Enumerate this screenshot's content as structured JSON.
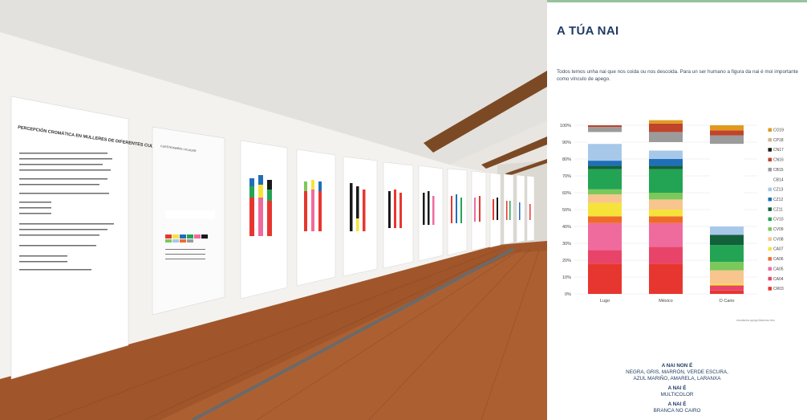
{
  "photo": {
    "panels": [
      {
        "heading": "PERCEPCIÓN CROMÁTICA EN MULLERES DE DIFERENTES CULTURAS"
      },
      {
        "heading": "CUESTIONARIO / PLACER"
      }
    ]
  },
  "poster": {
    "title": "A TÚA NAI",
    "intro": "Todos temos unha nai que nos coida ou nos descoida. Para un ser humano a figura da nai é moi importante como vínculo de apego.",
    "source_note": "resultados.apego/historias.tres",
    "bottom": {
      "line1": "A NAI NON É",
      "line2": "NEGRA, GRIS, MARRÓN, VERDE ESCURA,",
      "line3": "AZUL MARIÑO, AMARELA, LARANXA",
      "line4": "A NAI É",
      "line5": "MULTICOLOR",
      "line6": "A NAI É",
      "line7": "BRANCA NO CAIRO"
    }
  },
  "chart_data": {
    "type": "bar",
    "stacked": true,
    "categories": [
      "Lugo",
      "México",
      "O Cairo"
    ],
    "y_ticks": [
      "0%",
      "10%",
      "20%",
      "30%",
      "40%",
      "50%",
      "60%",
      "70%",
      "80%",
      "90%",
      "100%"
    ],
    "ylim": [
      0,
      100
    ],
    "grid": true,
    "legend_position": "right",
    "series": [
      {
        "name": "CR03",
        "color": "#e7362f",
        "values": [
          18,
          18,
          2
        ]
      },
      {
        "name": "CA04",
        "color": "#e8446a",
        "values": [
          8,
          10,
          3
        ]
      },
      {
        "name": "CA05",
        "color": "#f06b9d",
        "values": [
          16,
          14,
          0
        ]
      },
      {
        "name": "CA06",
        "color": "#ef6b2a",
        "values": [
          4,
          4,
          0
        ]
      },
      {
        "name": "CA07",
        "color": "#f6e33a",
        "values": [
          8,
          4,
          1
        ]
      },
      {
        "name": "CV08",
        "color": "#f8c58e",
        "values": [
          5,
          6,
          8
        ]
      },
      {
        "name": "CV09",
        "color": "#7ac95a",
        "values": [
          3,
          4,
          5
        ]
      },
      {
        "name": "CV10",
        "color": "#23a455",
        "values": [
          12,
          14,
          10
        ]
      },
      {
        "name": "CZ11",
        "color": "#12613a",
        "values": [
          2,
          2,
          6
        ]
      },
      {
        "name": "CZ12",
        "color": "#1f6fb8",
        "values": [
          3,
          4,
          0
        ]
      },
      {
        "name": "CZ13",
        "color": "#a8c8ea",
        "values": [
          10,
          5,
          5
        ]
      },
      {
        "name": "CB14",
        "color": "#ffffff",
        "values": [
          7,
          5,
          49
        ]
      },
      {
        "name": "CB15",
        "color": "#9b9b9b",
        "values": [
          3,
          6,
          5
        ]
      },
      {
        "name": "CN16",
        "color": "#c0432b",
        "values": [
          1,
          5,
          3
        ]
      },
      {
        "name": "CN17",
        "color": "#1a1a1a",
        "values": [
          0,
          0,
          0
        ]
      },
      {
        "name": "CP18",
        "color": "#d2b48c",
        "values": [
          0,
          0,
          0
        ]
      },
      {
        "name": "CO19",
        "color": "#e09a1e",
        "values": [
          0,
          2,
          3
        ]
      }
    ]
  }
}
